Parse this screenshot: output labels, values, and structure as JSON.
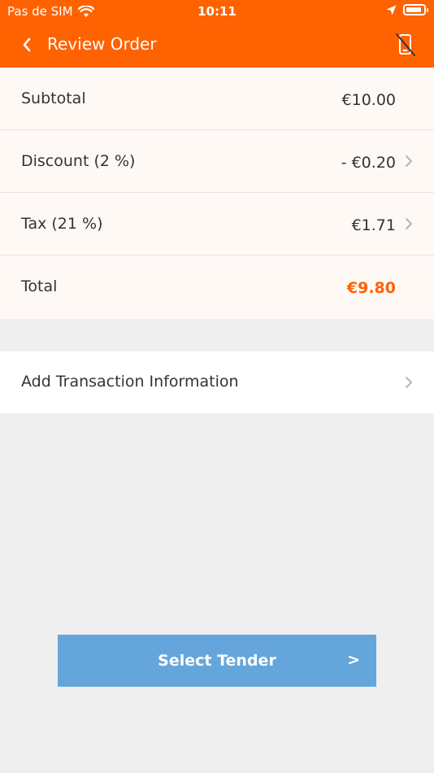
{
  "status_bar": {
    "carrier": "Pas de SIM",
    "time": "10:11"
  },
  "nav": {
    "title": "Review Order",
    "back_icon": "chevron-left-icon",
    "right_icon": "no-device-icon"
  },
  "summary": [
    {
      "label": "Subtotal",
      "value": "€10.00",
      "has_chevron": false
    },
    {
      "label": "Discount (2 %)",
      "value": "- €0.20",
      "has_chevron": true
    },
    {
      "label": "Tax (21 %)",
      "value": "€1.71",
      "has_chevron": true
    },
    {
      "label": "Total",
      "value": "€9.80",
      "has_chevron": false
    }
  ],
  "transaction": {
    "label": "Add Transaction Information"
  },
  "tender_button": {
    "label": "Select Tender",
    "arrow": ">"
  },
  "colors": {
    "brand": "#ff6200",
    "button": "#64a6db",
    "background": "#efefef"
  }
}
